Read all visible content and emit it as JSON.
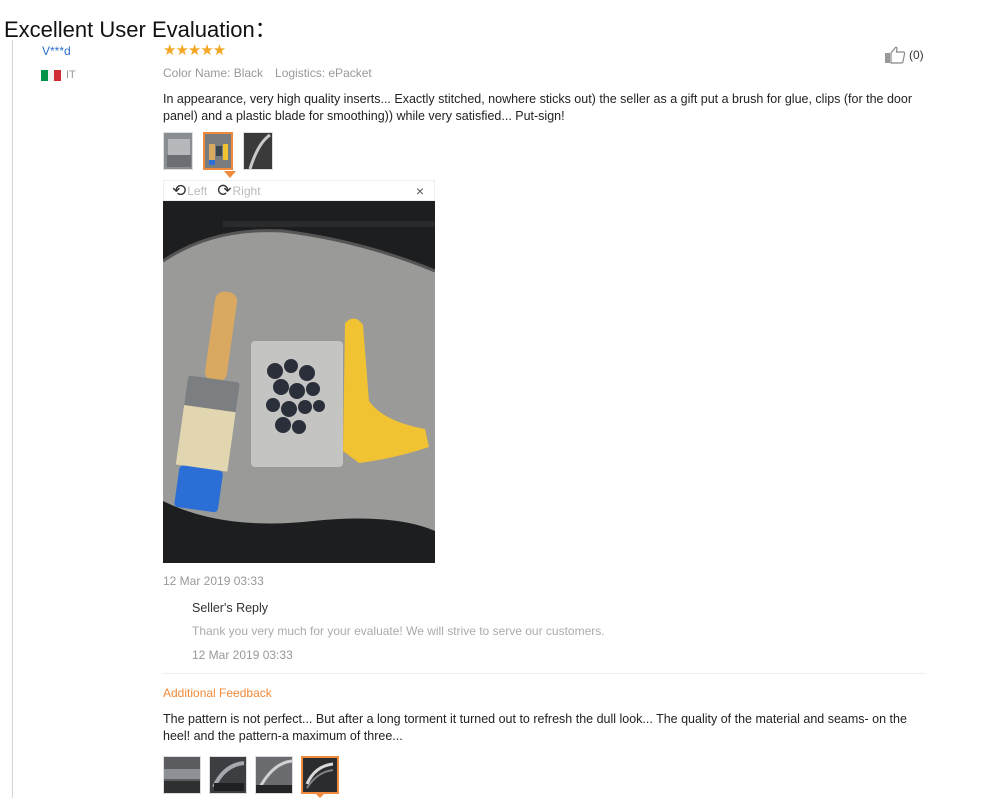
{
  "heading": "Excellent User Evaluation：",
  "review": {
    "user": {
      "name": "V***d",
      "country": "IT",
      "flag_colors": [
        "#009246",
        "#ffffff",
        "#ce2b37"
      ]
    },
    "rating": {
      "stars": 5,
      "max": 5,
      "display": "★★★★★"
    },
    "meta": {
      "color_name": "Color Name: Black",
      "logistics": "Logistics: ePacket"
    },
    "like": {
      "icon": "thumbs-up-icon",
      "count_label": "(0)"
    },
    "text": "In appearance, very high quality inserts... Exactly stitched, nowhere sticks out) the seller as a gift put a brush for glue, clips (for the door panel) and a plastic blade for smoothing)) while very satisfied... Put-sign!",
    "photo_count": 3,
    "active_photo_index": 1,
    "viewer": {
      "rotate_left_label": "Left",
      "rotate_right_label": "Right",
      "rotate_left_icon": "rotate-left-icon",
      "rotate_right_icon": "rotate-right-icon",
      "close_icon": "close-icon",
      "close_glyph": "×"
    },
    "date": "12 Mar 2019 03:33",
    "seller_reply": {
      "title": "Seller's Reply",
      "text": "Thank you very much for your evaluate! We will strive to serve our customers.",
      "date": "12 Mar 2019 03:33"
    },
    "additional_feedback": {
      "title": "Additional Feedback",
      "text": "The pattern is not perfect... But after a long torment it turned out to refresh the dull look... The quality of the material and seams- on the heel! and the pattern-a maximum of three...",
      "photo_count": 4,
      "active_photo_index": 3
    }
  },
  "colors": {
    "accent": "#f08a3c",
    "star": "#f5a623",
    "link": "#2d6fc6",
    "muted": "#999999"
  }
}
